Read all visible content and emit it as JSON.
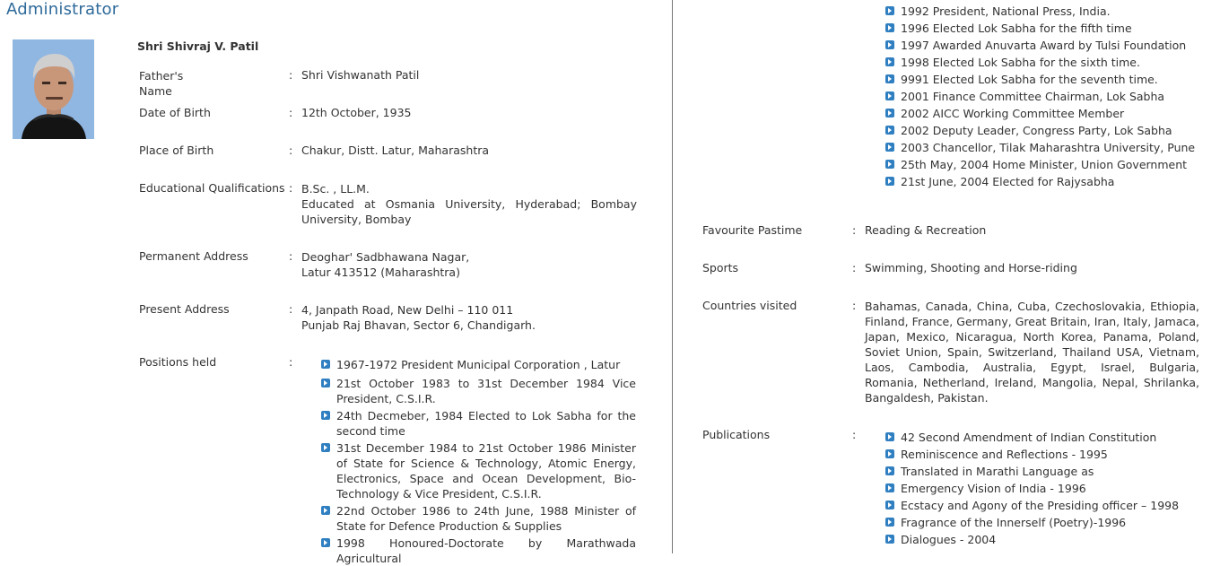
{
  "page": {
    "title": "Administrator"
  },
  "profile": {
    "name": "Shri Shivraj V. Patil",
    "fathers_name": {
      "label": "Father's Name",
      "value": "Shri Vishwanath Patil"
    },
    "date_of_birth": {
      "label": "Date of Birth",
      "value": "12th October, 1935"
    },
    "place_of_birth": {
      "label": "Place of Birth",
      "value": "Chakur, Distt. Latur, Maharashtra"
    },
    "education": {
      "label": "Educational Qualifications",
      "lines": [
        "B.Sc. , LL.M.",
        "Educated at Osmania University, Hyderabad; Bombay University, Bombay"
      ]
    },
    "permanent_address": {
      "label": "Permanent Address",
      "lines": [
        "Deoghar' Sadbhawana Nagar,",
        "Latur 413512 (Maharashtra)"
      ]
    },
    "present_address": {
      "label": "Present Address",
      "lines": [
        "4, Janpath Road, New Delhi – 110 011",
        "Punjab Raj Bhavan, Sector 6, Chandigarh."
      ]
    },
    "positions": {
      "label": "Positions held",
      "items": [
        "1967-1972 President Municipal Corporation , Latur",
        "21st October 1983 to 31st December 1984 Vice President, C.S.I.R.",
        "24th Decmeber, 1984 Elected to Lok Sabha for the second time",
        "31st December 1984 to 21st October 1986 Minister of State for Science & Technology, Atomic Energy, Electronics, Space and Ocean Development, Bio-Technology & Vice President, C.S.I.R.",
        "22nd October 1986 to 24th June, 1988 Minister of State for Defence Production & Supplies",
        "1998 Honoured-Doctorate by Marathwada Agricultural"
      ],
      "continued_items": [
        "1992 President, National Press, India.",
        "1996 Elected Lok Sabha for the fifth time",
        "1997 Awarded Anuvarta Award by Tulsi Foundation",
        "1998 Elected Lok Sabha for the sixth time.",
        "9991 Elected Lok Sabha for the seventh time.",
        "2001 Finance Committee Chairman, Lok Sabha",
        "2002 AICC Working Committee Member",
        "2002 Deputy Leader, Congress Party, Lok Sabha",
        "2003 Chancellor, Tilak Maharashtra University, Pune",
        "25th May, 2004 Home Minister, Union Government",
        "21st June, 2004 Elected for Rajysabha"
      ]
    },
    "pastime": {
      "label": "Favourite Pastime",
      "value": "Reading & Recreation"
    },
    "sports": {
      "label": "Sports",
      "value": "Swimming, Shooting and Horse-riding"
    },
    "countries": {
      "label": "Countries visited",
      "value": "Bahamas, Canada, China, Cuba, Czechoslovakia, Ethiopia, Finland, France, Germany, Great Britain, Iran, Italy, Jamaca, Japan, Mexico, Nicaragua, North Korea, Panama, Poland, Soviet Union, Spain, Switzerland, Thailand USA, Vietnam, Laos, Cambodia, Australia, Egypt, Israel, Bulgaria, Romania, Netherland, Ireland, Mangolia, Nepal, Shrilanka, Bangaldesh, Pakistan."
    },
    "publications": {
      "label": "Publications",
      "items": [
        "42 Second Amendment of Indian Constitution",
        "Reminiscence and Reflections - 1995",
        "Translated in Marathi Language as",
        "Emergency Vision of India - 1996",
        "Ecstacy and Agony of the Presiding officer – 1998",
        "Fragrance of the Innerself (Poetry)-1996",
        "Dialogues - 2004"
      ]
    }
  },
  "colon": ":",
  "icons": {
    "bullet": "arrow-right-icon",
    "photo": "portrait-photo"
  },
  "colors": {
    "title": "#2e6a9a",
    "bullet": "#2f7fc1"
  }
}
